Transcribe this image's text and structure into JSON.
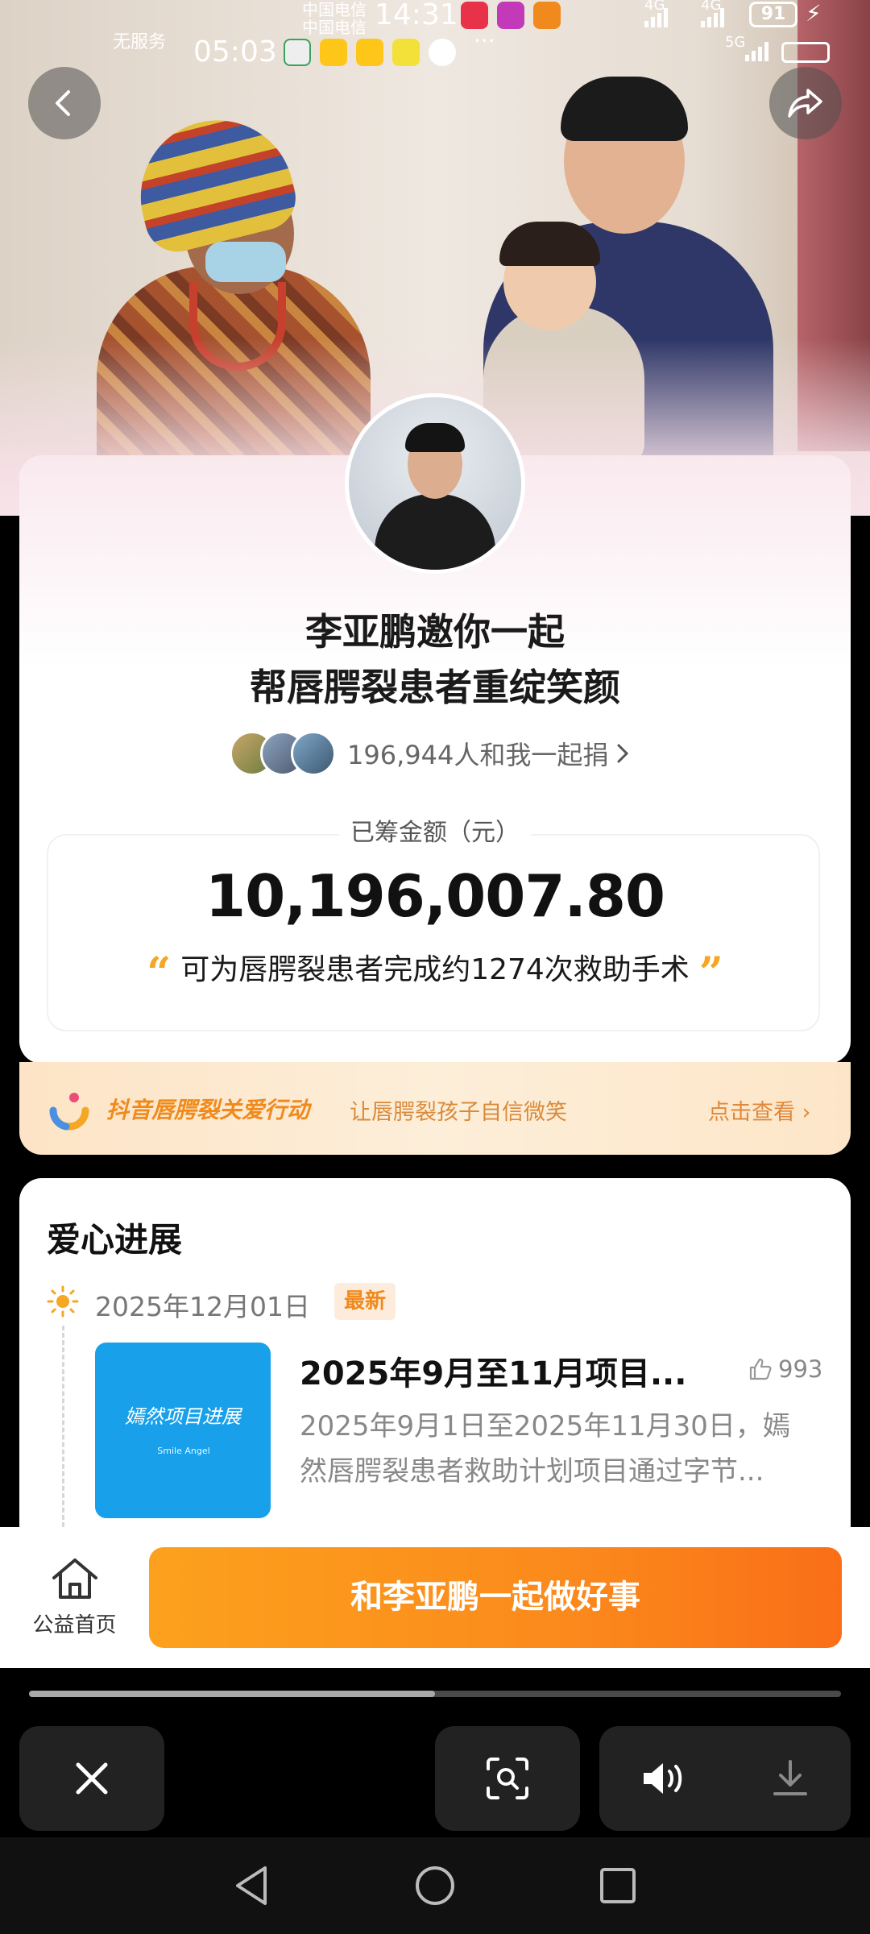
{
  "status_bar": {
    "carrier_1": "中国电信",
    "carrier_2": "中国电信",
    "no_service": "无服务",
    "time_top": "14:31",
    "time_overlay": "05:03",
    "battery": "91",
    "network_1": "4G",
    "network_2": "4G",
    "network_3": "5G",
    "dots": "···"
  },
  "hero": {
    "back_icon": "chevron-left-icon",
    "share_icon": "share-arrow-icon"
  },
  "campaign": {
    "title_line_1": "李亚鹏邀你一起",
    "title_line_2": "帮唇腭裂患者重绽笑颜",
    "donor_count_text": "196,944人和我一起捐",
    "amount_label": "已筹金额（元）",
    "amount": "10,196,007.80",
    "impact_text": "可为唇腭裂患者完成约1274次救助手术",
    "quote_open": "“",
    "quote_close": "”"
  },
  "banner": {
    "title": "抖音唇腭裂关爱行动",
    "subtitle": "让唇腭裂孩子自信微笑",
    "link": "点击查看",
    "link_arrow": "›"
  },
  "progress": {
    "section_title": "爱心进展",
    "date": "2025年12月01日",
    "new_tag": "最新",
    "thumb_title": "嫣然项目进展",
    "thumb_brand": "Smile Angel",
    "post_title": "2025年9月至11月项目...",
    "likes": "993",
    "post_body": "2025年9月1日至2025年11月30日，嫣然唇腭裂患者救助计划项目通过字节..."
  },
  "bottom_bar": {
    "home_label": "公益首页",
    "cta_label": "和李亚鹏一起做好事"
  },
  "overlay": {
    "progress_fraction": 0.5
  },
  "colors": {
    "accent_orange": "#fb8a1c",
    "amount_text": "#111111",
    "quote_mark": "#f5a623",
    "thumb_blue": "#18a1ea"
  }
}
